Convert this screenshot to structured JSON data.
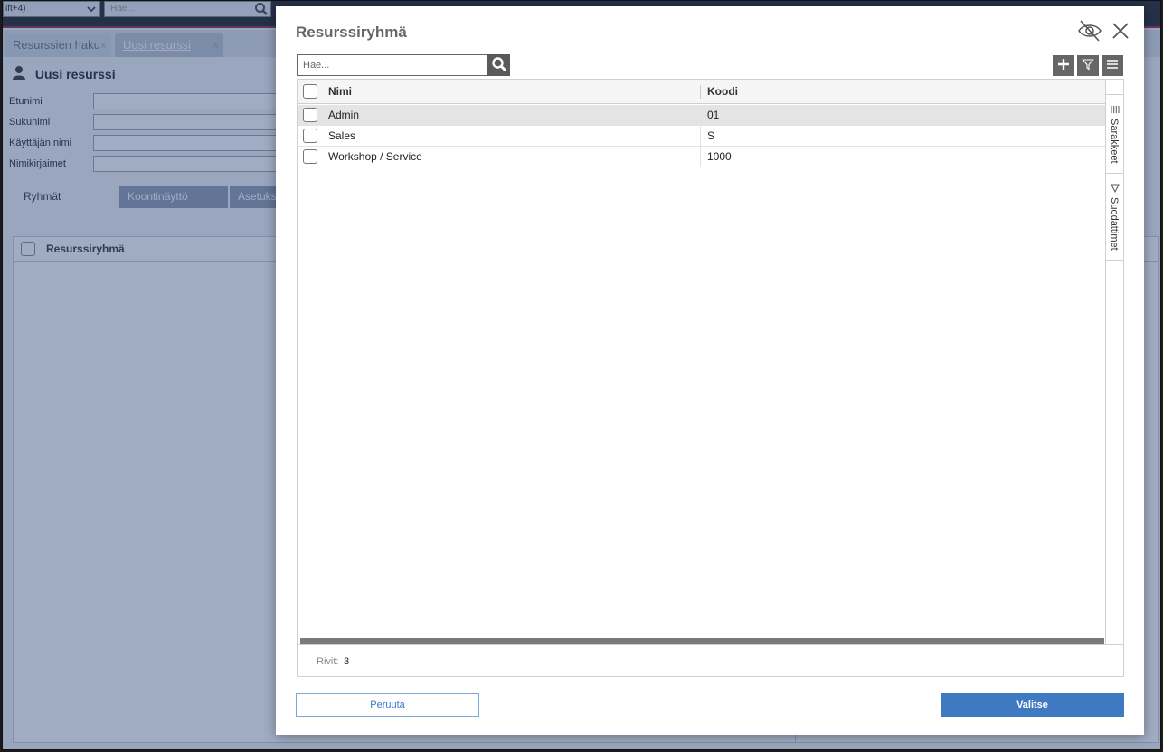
{
  "app": {
    "topbar": {
      "selector_value": "ift+4)",
      "search_placeholder": "Hae..."
    },
    "tabs": [
      {
        "label": "Resurssien haku",
        "close": "x"
      },
      {
        "label": "Uusi resurssi",
        "close": "x"
      }
    ],
    "page_title": "Uusi resurssi",
    "fields": [
      {
        "label": "Etunimi"
      },
      {
        "label": "Sukunimi"
      },
      {
        "label": "Käyttäjän nimi"
      },
      {
        "label": "Nimikirjaimet"
      }
    ],
    "sub_tabs": [
      "Ryhmät",
      "Koontinäyttö",
      "Asetuks"
    ],
    "table_header": "Resurssiryhmä"
  },
  "modal": {
    "title": "Resurssiryhmä",
    "search_placeholder": "Hae...",
    "columns": {
      "name": "Nimi",
      "code": "Koodi"
    },
    "rows": [
      {
        "name": "Admin",
        "code": "01",
        "selected": true
      },
      {
        "name": "Sales",
        "code": "S",
        "selected": false
      },
      {
        "name": "Workshop / Service",
        "code": "1000",
        "selected": false
      }
    ],
    "side_tabs": {
      "columns": "Sarakkeet",
      "filters": "Suodattimet"
    },
    "footer": {
      "rows_label": "Rivit:",
      "rows_count": "3"
    },
    "buttons": {
      "cancel": "Peruuta",
      "select": "Valitse"
    }
  },
  "colors": {
    "primary": "#3f79c2",
    "overlay": "#2c4878",
    "accent_red": "#9b2335"
  }
}
